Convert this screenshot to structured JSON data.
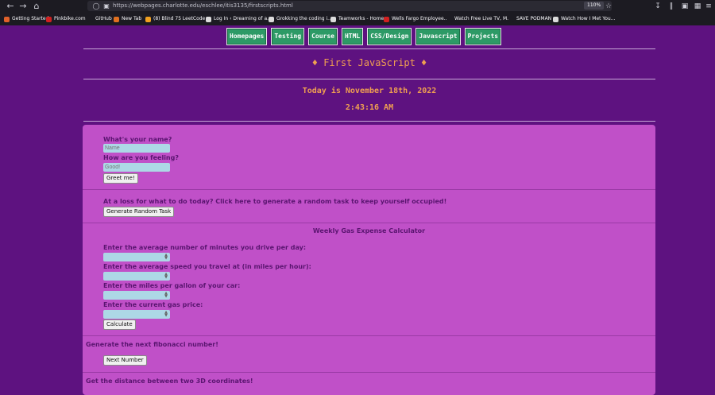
{
  "browser": {
    "url": "https://webpages.charlotte.edu/eschlee/itis3135/firstscripts.html",
    "zoom": "110%",
    "bookmarks": [
      {
        "label": "Getting Started",
        "color": "#e0612a"
      },
      {
        "label": "Pinkbike.com",
        "color": "#d02020"
      },
      {
        "label": "GitHub",
        "color": "#1c1b22"
      },
      {
        "label": "New Tab",
        "color": "#e07020"
      },
      {
        "label": "(8) Blind 75 LeetCode ...",
        "color": "#f0a020"
      },
      {
        "label": "Log In ‹ Dreaming of a...",
        "color": "#dcdcdc"
      },
      {
        "label": "Grokking the coding i...",
        "color": "#dcdcdc"
      },
      {
        "label": "Teamworks - Home",
        "color": "#dcdcdc"
      },
      {
        "label": "Wells Fargo Employee...",
        "color": "#d02020"
      },
      {
        "label": "Watch Free Live TV, M...",
        "color": "#1c1b22"
      },
      {
        "label": "SAVE PODMAN",
        "color": "#1c1b22"
      },
      {
        "label": "Watch How I Met You...",
        "color": "#dcdcdc"
      }
    ]
  },
  "nav": [
    "Homepages",
    "Testing",
    "Course",
    "HTML",
    "CSS/Design",
    "Javascript",
    "Projects"
  ],
  "header": {
    "title": "♦ First JavaScript ♦",
    "date_line": "Today is November 18th, 2022",
    "clock": "2:43:16 AM"
  },
  "greet": {
    "name_label": "What's your name?",
    "name_placeholder": "Name",
    "feeling_label": "How are you feeling?",
    "feeling_placeholder": "Good!",
    "button": "Greet me!"
  },
  "random_task": {
    "prompt": "At a loss for what to do today? Click here to generate a random task to keep yourself occupied!",
    "button": "Generate Random Task"
  },
  "gas_calc": {
    "title": "Weekly Gas Expense Calculator",
    "fields": [
      "Enter the average number of minutes you drive per day:",
      "Enter the average speed you travel at (in miles per hour):",
      "Enter the miles per gallon of your car:",
      "Enter the current gas price:"
    ],
    "button": "Calculate"
  },
  "fibonacci": {
    "label": "Generate the next fibonacci number!",
    "button": "Next Number"
  },
  "distance": {
    "label": "Get the distance between two 3D coordinates!"
  },
  "colors": {
    "background": "#5e1280",
    "panel": "#c050c8",
    "nav_button": "#2d9a66",
    "header_text": "#f0a050",
    "label_text": "#5a1570",
    "input": "#add8e6"
  }
}
